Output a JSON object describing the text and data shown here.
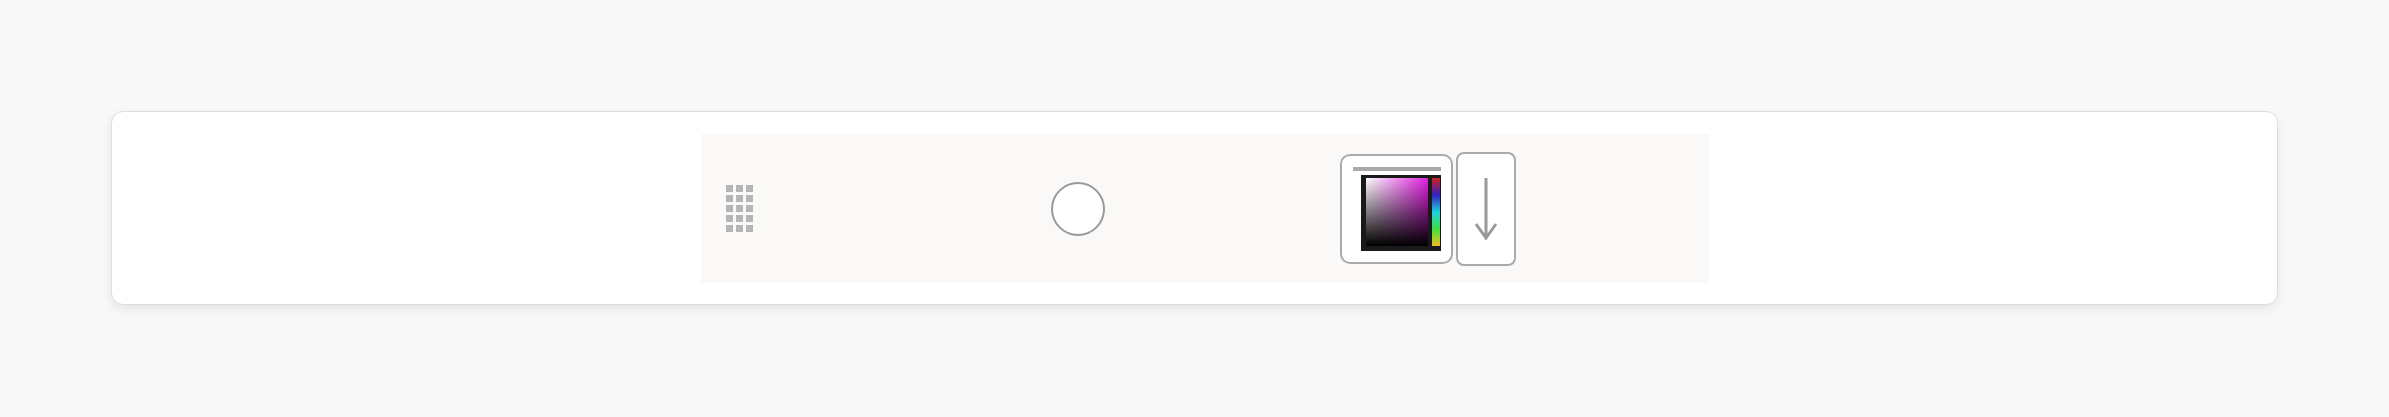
{
  "toolbar": {
    "items": [
      {
        "kind": "drag-handle"
      },
      {
        "kind": "radio",
        "checked": false
      },
      {
        "kind": "color-picker"
      },
      {
        "kind": "arrow-button"
      }
    ]
  }
}
